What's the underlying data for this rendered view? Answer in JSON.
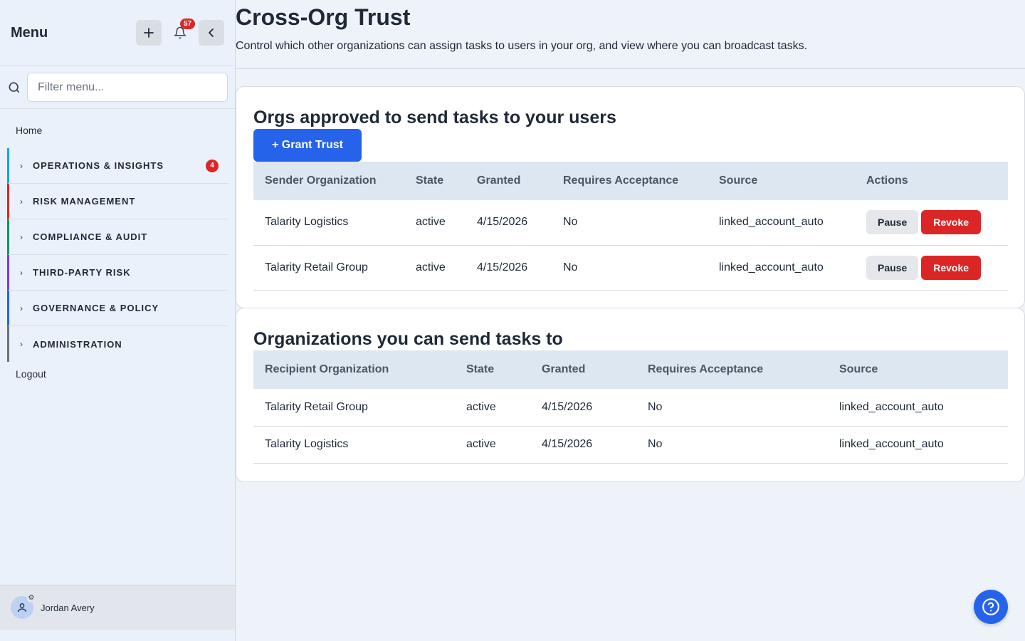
{
  "sidebar": {
    "title": "Menu",
    "notification_count": "57",
    "search_placeholder": "Filter menu...",
    "home_label": "Home",
    "sections": [
      {
        "label": "OPERATIONS & INSIGHTS",
        "color": "#0ea5e9",
        "count": "4"
      },
      {
        "label": "RISK MANAGEMENT",
        "color": "#dc2626"
      },
      {
        "label": "COMPLIANCE & AUDIT",
        "color": "#059669"
      },
      {
        "label": "THIRD-PARTY RISK",
        "color": "#7c3aed"
      },
      {
        "label": "GOVERNANCE & POLICY",
        "color": "#2563eb"
      },
      {
        "label": "ADMINISTRATION",
        "color": "#6b7280"
      }
    ],
    "logout_label": "Logout",
    "user_name": "Jordan Avery"
  },
  "page": {
    "title": "Cross-Org Trust",
    "subtitle": "Control which other organizations can assign tasks to users in your org, and view where you can broadcast tasks."
  },
  "inbound": {
    "title": "Orgs approved to send tasks to your users",
    "grant_label": "+ Grant Trust",
    "columns": [
      "Sender Organization",
      "State",
      "Granted",
      "Requires Acceptance",
      "Source",
      "Actions"
    ],
    "rows": [
      {
        "org": "Talarity Logistics",
        "state": "active",
        "granted": "4/15/2026",
        "requires": "No",
        "source": "linked_account_auto",
        "pause": "Pause",
        "revoke": "Revoke"
      },
      {
        "org": "Talarity Retail Group",
        "state": "active",
        "granted": "4/15/2026",
        "requires": "No",
        "source": "linked_account_auto",
        "pause": "Pause",
        "revoke": "Revoke"
      }
    ]
  },
  "outbound": {
    "title": "Organizations you can send tasks to",
    "columns": [
      "Recipient Organization",
      "State",
      "Granted",
      "Requires Acceptance",
      "Source"
    ],
    "rows": [
      {
        "org": "Talarity Retail Group",
        "state": "active",
        "granted": "4/15/2026",
        "requires": "No",
        "source": "linked_account_auto"
      },
      {
        "org": "Talarity Logistics",
        "state": "active",
        "granted": "4/15/2026",
        "requires": "No",
        "source": "linked_account_auto"
      }
    ]
  },
  "colors": {
    "primary": "#2563eb",
    "danger": "#dc2626",
    "table_header_bg": "#dde7f2"
  }
}
